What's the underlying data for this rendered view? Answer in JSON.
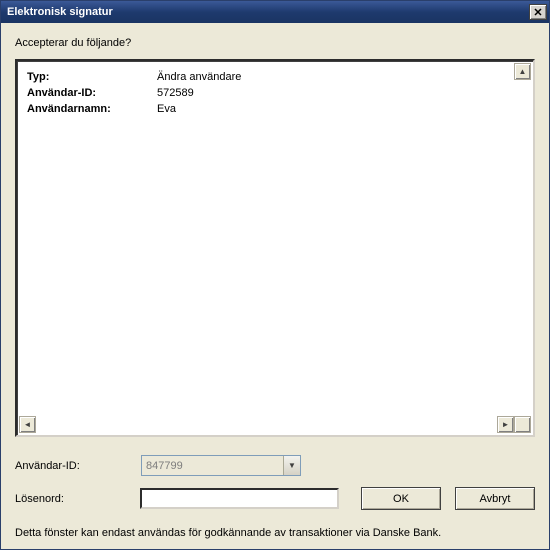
{
  "window": {
    "title": "Elektronisk signatur"
  },
  "prompt": "Accepterar du följande?",
  "details": {
    "type_label": "Typ:",
    "type_value": "Ändra användare",
    "userid_label": "Användar-ID:",
    "userid_value": "572589",
    "username_label": "Användarnamn:",
    "username_value": "Eva"
  },
  "form": {
    "userid_label": "Användar-ID:",
    "userid_value": "847799",
    "password_label": "Lösenord:",
    "password_value": ""
  },
  "buttons": {
    "ok": "OK",
    "cancel": "Avbryt"
  },
  "footer": "Detta fönster kan endast användas för godkännande av transaktioner via Danske Bank."
}
